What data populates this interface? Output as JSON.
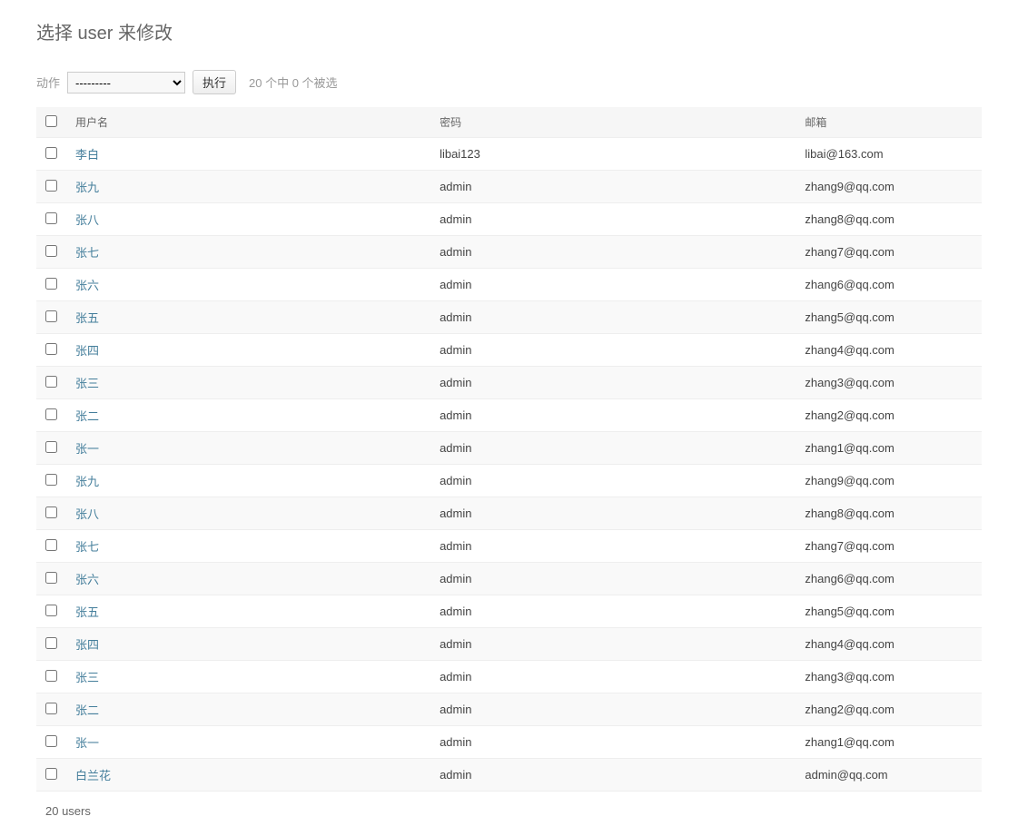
{
  "page": {
    "title": "选择 user 来修改"
  },
  "actions": {
    "label": "动作",
    "placeholder": "---------",
    "button": "执行",
    "selection_count": "20 个中 0 个被选"
  },
  "table": {
    "headers": {
      "username": "用户名",
      "password": "密码",
      "email": "邮箱"
    },
    "rows": [
      {
        "username": "李白",
        "password": "libai123",
        "email": "libai@163.com"
      },
      {
        "username": "张九",
        "password": "admin",
        "email": "zhang9@qq.com"
      },
      {
        "username": "张八",
        "password": "admin",
        "email": "zhang8@qq.com"
      },
      {
        "username": "张七",
        "password": "admin",
        "email": "zhang7@qq.com"
      },
      {
        "username": "张六",
        "password": "admin",
        "email": "zhang6@qq.com"
      },
      {
        "username": "张五",
        "password": "admin",
        "email": "zhang5@qq.com"
      },
      {
        "username": "张四",
        "password": "admin",
        "email": "zhang4@qq.com"
      },
      {
        "username": "张三",
        "password": "admin",
        "email": "zhang3@qq.com"
      },
      {
        "username": "张二",
        "password": "admin",
        "email": "zhang2@qq.com"
      },
      {
        "username": "张一",
        "password": "admin",
        "email": "zhang1@qq.com"
      },
      {
        "username": "张九",
        "password": "admin",
        "email": "zhang9@qq.com"
      },
      {
        "username": "张八",
        "password": "admin",
        "email": "zhang8@qq.com"
      },
      {
        "username": "张七",
        "password": "admin",
        "email": "zhang7@qq.com"
      },
      {
        "username": "张六",
        "password": "admin",
        "email": "zhang6@qq.com"
      },
      {
        "username": "张五",
        "password": "admin",
        "email": "zhang5@qq.com"
      },
      {
        "username": "张四",
        "password": "admin",
        "email": "zhang4@qq.com"
      },
      {
        "username": "张三",
        "password": "admin",
        "email": "zhang3@qq.com"
      },
      {
        "username": "张二",
        "password": "admin",
        "email": "zhang2@qq.com"
      },
      {
        "username": "张一",
        "password": "admin",
        "email": "zhang1@qq.com"
      },
      {
        "username": "白兰花",
        "password": "admin",
        "email": "admin@qq.com"
      }
    ]
  },
  "paginator": {
    "text": "20 users"
  }
}
